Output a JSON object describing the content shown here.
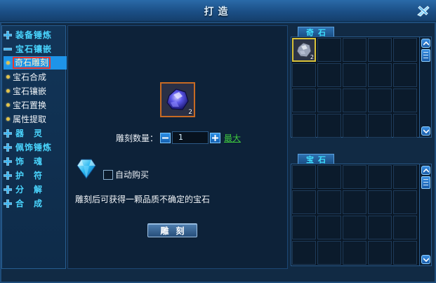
{
  "window": {
    "title": "打造"
  },
  "sidebar": {
    "items": [
      {
        "kind": "category",
        "icon": "plus-icon",
        "label": "装备锤炼"
      },
      {
        "kind": "category",
        "icon": "minus-icon",
        "label": "宝石镶嵌",
        "expanded": true
      },
      {
        "kind": "sub",
        "label": "奇石雕刻",
        "active": true
      },
      {
        "kind": "sub",
        "label": "宝石合成"
      },
      {
        "kind": "sub",
        "label": "宝石镶嵌"
      },
      {
        "kind": "sub",
        "label": "宝石置换"
      },
      {
        "kind": "sub",
        "label": "属性提取"
      },
      {
        "kind": "category",
        "icon": "plus-icon",
        "label": "器　灵"
      },
      {
        "kind": "category",
        "icon": "plus-icon",
        "label": "佩饰锤炼"
      },
      {
        "kind": "category",
        "icon": "plus-icon",
        "label": "饰　魂"
      },
      {
        "kind": "category",
        "icon": "plus-icon",
        "label": "护　符"
      },
      {
        "kind": "category",
        "icon": "plus-icon",
        "label": "分　解"
      },
      {
        "kind": "category",
        "icon": "plus-icon",
        "label": "合　成"
      }
    ]
  },
  "main": {
    "slot_count": "2",
    "qty_label": "雕刻数量：",
    "qty_value": "1",
    "max_label": "最大",
    "auto_buy_label": "自动购买",
    "description": "雕刻后可获得一颗品质不确定的宝石",
    "carve_button": "雕刻"
  },
  "panels": {
    "odd_stone": {
      "tab": "奇石",
      "first_item_count": "2"
    },
    "gem": {
      "tab": "宝石"
    }
  },
  "colors": {
    "accent": "#1e94e8",
    "category_text": "#4ad6ff",
    "max_link": "#3ec93e",
    "active_outline": "#e8362e",
    "slot_border": "#c76a23",
    "selected_cell": "#d8c23a"
  }
}
